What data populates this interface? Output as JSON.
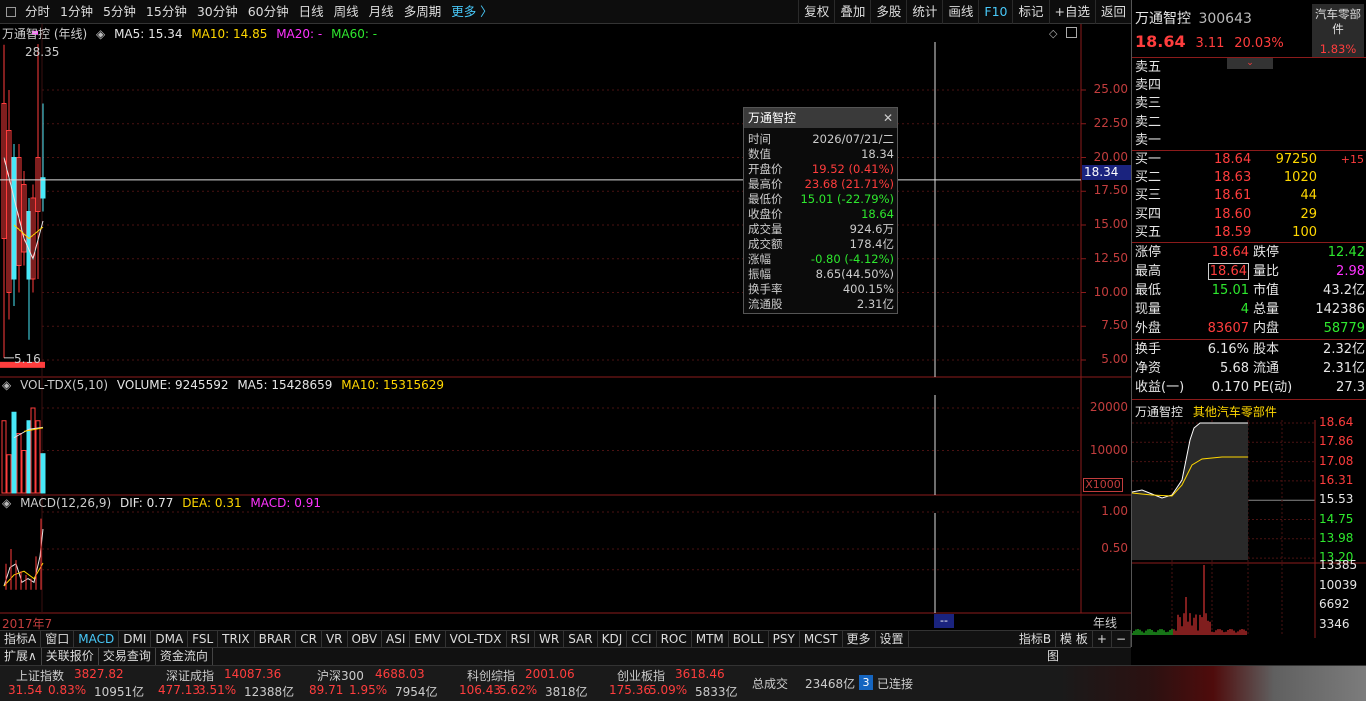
{
  "toolbar": {
    "periods": [
      "分时",
      "1分钟",
      "5分钟",
      "15分钟",
      "30分钟",
      "60分钟",
      "日线",
      "周线",
      "月线",
      "多周期",
      "更多 〉"
    ],
    "tools": [
      "复权",
      "叠加",
      "多股",
      "统计",
      "画线",
      "F10",
      "标记",
      "+自选",
      "返回"
    ]
  },
  "main_chart": {
    "name": "万通智控 (年线)",
    "ma5": "MA5: 15.34",
    "ma10": "MA10: 14.85",
    "ma20": "MA20: -",
    "ma60": "MA60: -",
    "high_mark": "28.35",
    "low_mark": "5.16",
    "y_ticks": [
      "25.00",
      "22.50",
      "20.00",
      "17.50",
      "15.00",
      "12.50",
      "10.00",
      "7.50",
      "5.00"
    ],
    "cursor_value": "18.34"
  },
  "vol_chart": {
    "name": "VOL-TDX(5,10)",
    "volume": "VOLUME: 9245592",
    "ma5": "MA5: 15428659",
    "ma10": "MA10: 15315629",
    "y_ticks": [
      "20000",
      "10000"
    ],
    "unit": "X1000"
  },
  "macd_chart": {
    "name": "MACD(12,26,9)",
    "dif": "DIF: 0.77",
    "dea": "DEA: 0.31",
    "macd": "MACD: 0.91",
    "y_ticks": [
      "1.00",
      "0.50"
    ]
  },
  "x_axis": {
    "start": "2017年7",
    "cursor": "--",
    "period": "年线"
  },
  "tooltip": {
    "title": "万通智控",
    "rows": [
      {
        "k": "时间",
        "v": "2026/07/21/二",
        "color": "#ccc"
      },
      {
        "k": "数值",
        "v": "18.34",
        "color": "#ccc"
      },
      {
        "k": "开盘价",
        "v": "19.52 (0.41%)",
        "color": "#ff3d3d"
      },
      {
        "k": "最高价",
        "v": "23.68 (21.71%)",
        "color": "#ff3d3d"
      },
      {
        "k": "最低价",
        "v": "15.01 (-22.79%)",
        "color": "#2ee82e"
      },
      {
        "k": "收盘价",
        "v": "18.64",
        "color": "#2ee82e"
      },
      {
        "k": "成交量",
        "v": "924.6万",
        "color": "#ccc"
      },
      {
        "k": "成交额",
        "v": "178.4亿",
        "color": "#ccc"
      },
      {
        "k": "涨幅",
        "v": "-0.80 (-4.12%)",
        "color": "#2ee82e"
      },
      {
        "k": "振幅",
        "v": "8.65(44.50%)",
        "color": "#ccc"
      },
      {
        "k": "换手率",
        "v": "400.15%",
        "color": "#ccc"
      },
      {
        "k": "流通股",
        "v": "2.31亿",
        "color": "#ccc"
      }
    ]
  },
  "quote": {
    "name": "万通智控",
    "code": "300643",
    "sector_badge": "汽车零部件",
    "badge_pct": "1.83%",
    "price": "18.64",
    "change": "3.11",
    "pct": "20.03%",
    "sells": [
      "卖五",
      "卖四",
      "卖三",
      "卖二",
      "卖一"
    ],
    "buys": [
      {
        "label": "买一",
        "price": "18.64",
        "vol": "97250",
        "extra": "+15"
      },
      {
        "label": "买二",
        "price": "18.63",
        "vol": "1020",
        "extra": ""
      },
      {
        "label": "买三",
        "price": "18.61",
        "vol": "44",
        "extra": ""
      },
      {
        "label": "买四",
        "price": "18.60",
        "vol": "29",
        "extra": ""
      },
      {
        "label": "买五",
        "price": "18.59",
        "vol": "100",
        "extra": ""
      }
    ],
    "stats1": [
      {
        "k1": "涨停",
        "v1": "18.64",
        "c1": "red",
        "k2": "跌停",
        "v2": "12.42",
        "c2": "grn"
      },
      {
        "k1": "最高",
        "v1": "18.64",
        "c1": "red",
        "k2": "量比",
        "v2": "2.98",
        "c2": "mag"
      },
      {
        "k1": "最低",
        "v1": "15.01",
        "c1": "grn",
        "k2": "市值",
        "v2": "43.2亿",
        "c2": "wht"
      },
      {
        "k1": "现量",
        "v1": "4",
        "c1": "grn",
        "k2": "总量",
        "v2": "142386",
        "c2": "wht"
      },
      {
        "k1": "外盘",
        "v1": "83607",
        "c1": "red",
        "k2": "内盘",
        "v2": "58779",
        "c2": "grn"
      }
    ],
    "stats2": [
      {
        "k1": "换手",
        "v1": "6.16%",
        "k2": "股本",
        "v2": "2.32亿"
      },
      {
        "k1": "净资",
        "v1": "5.68",
        "k2": "流通",
        "v2": "2.31亿"
      },
      {
        "k1": "收益(一)",
        "v1": "0.170",
        "k2": "PE(动)",
        "v2": "27.3"
      }
    ]
  },
  "mini_chart": {
    "name": "万通智控",
    "sector": "其他汽车零部件",
    "price_ticks": [
      "18.64",
      "17.86",
      "17.08",
      "16.31",
      "15.53",
      "14.75",
      "13.98",
      "13.20"
    ],
    "vol_ticks": [
      "13385",
      "10039",
      "6692",
      "3346"
    ]
  },
  "indicators": [
    "指标A",
    "窗口",
    "MACD",
    "DMI",
    "DMA",
    "FSL",
    "TRIX",
    "BRAR",
    "CR",
    "VR",
    "OBV",
    "ASI",
    "EMV",
    "VOL-TDX",
    "RSI",
    "WR",
    "SAR",
    "KDJ",
    "CCI",
    "ROC",
    "MTM",
    "BOLL",
    "PSY",
    "MCST",
    "更多",
    "设置"
  ],
  "indicator_right": [
    "指标B",
    "模 板",
    "+",
    "−"
  ],
  "ext_tabs": [
    "扩展∧",
    "关联报价",
    "交易查询",
    "资金流向"
  ],
  "ext_right": "图",
  "status": {
    "indices": [
      {
        "name": "上证指数",
        "value": "3827.82",
        "chg": "31.54",
        "pct": "0.83%",
        "amt": "10951亿"
      },
      {
        "name": "深证成指",
        "value": "14087.36",
        "chg": "477.13",
        "pct": "3.51%",
        "amt": "12388亿"
      },
      {
        "name": "沪深300",
        "value": "4688.03",
        "chg": "89.71",
        "pct": "1.95%",
        "amt": "7954亿"
      },
      {
        "name": "科创综指",
        "value": "2001.06",
        "chg": "106.43",
        "pct": "5.62%",
        "amt": "3818亿"
      },
      {
        "name": "创业板指",
        "value": "3618.46",
        "chg": "175.36",
        "pct": "5.09%",
        "amt": "5833亿"
      }
    ],
    "total_label": "总成交",
    "total_value": "23468亿",
    "conn_count": "3",
    "conn_text": "已连接"
  },
  "colors": {
    "up": "#ff3d3d",
    "down": "#2ee82e",
    "grid": "#8b1b1b",
    "accent": "#48c8f8"
  }
}
